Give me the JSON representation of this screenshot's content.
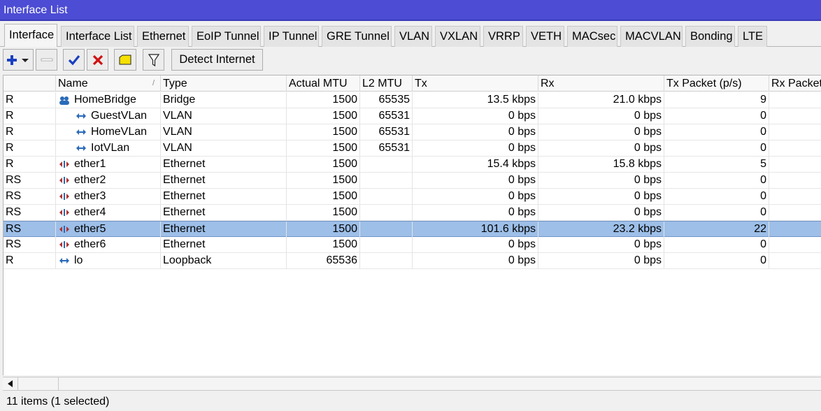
{
  "window": {
    "title": "Interface List"
  },
  "tabs": [
    {
      "label": "Interface",
      "active": true
    },
    {
      "label": "Interface List"
    },
    {
      "label": "Ethernet"
    },
    {
      "label": "EoIP Tunnel"
    },
    {
      "label": "IP Tunnel"
    },
    {
      "label": "GRE Tunnel"
    },
    {
      "label": "VLAN"
    },
    {
      "label": "VXLAN"
    },
    {
      "label": "VRRP"
    },
    {
      "label": "VETH"
    },
    {
      "label": "MACsec"
    },
    {
      "label": "MACVLAN"
    },
    {
      "label": "Bonding"
    },
    {
      "label": "LTE"
    }
  ],
  "toolbar": {
    "add_icon": "plus-dropdown-icon",
    "remove_icon": "minus-icon",
    "enable_icon": "checkmark-icon",
    "disable_icon": "x-icon",
    "comment_icon": "comment-note-icon",
    "filter_icon": "funnel-filter-icon",
    "detect_label": "Detect Internet"
  },
  "table": {
    "columns": [
      "",
      "Name",
      "Type",
      "Actual MTU",
      "L2 MTU",
      "Tx",
      "Rx",
      "Tx Packet (p/s)",
      "Rx Packet"
    ],
    "sort_indicator": "/",
    "rows": [
      {
        "flags": "R",
        "icon": "bridge-icon",
        "name": "HomeBridge",
        "type": "Bridge",
        "mtu": "1500",
        "l2mtu": "65535",
        "tx": "13.5 kbps",
        "rx": "21.0 kbps",
        "txp": "9",
        "indent": 0
      },
      {
        "flags": "R",
        "icon": "vlan-icon",
        "name": "GuestVLan",
        "type": "VLAN",
        "mtu": "1500",
        "l2mtu": "65531",
        "tx": "0 bps",
        "rx": "0 bps",
        "txp": "0",
        "indent": 1
      },
      {
        "flags": "R",
        "icon": "vlan-icon",
        "name": "HomeVLan",
        "type": "VLAN",
        "mtu": "1500",
        "l2mtu": "65531",
        "tx": "0 bps",
        "rx": "0 bps",
        "txp": "0",
        "indent": 1
      },
      {
        "flags": "R",
        "icon": "vlan-icon",
        "name": "IotVLan",
        "type": "VLAN",
        "mtu": "1500",
        "l2mtu": "65531",
        "tx": "0 bps",
        "rx": "0 bps",
        "txp": "0",
        "indent": 1
      },
      {
        "flags": "R",
        "icon": "ethernet-icon",
        "name": "ether1",
        "type": "Ethernet",
        "mtu": "1500",
        "l2mtu": "",
        "tx": "15.4 kbps",
        "rx": "15.8 kbps",
        "txp": "5",
        "indent": 0
      },
      {
        "flags": "RS",
        "icon": "ethernet-icon",
        "name": "ether2",
        "type": "Ethernet",
        "mtu": "1500",
        "l2mtu": "",
        "tx": "0 bps",
        "rx": "0 bps",
        "txp": "0",
        "indent": 0
      },
      {
        "flags": "RS",
        "icon": "ethernet-icon",
        "name": "ether3",
        "type": "Ethernet",
        "mtu": "1500",
        "l2mtu": "",
        "tx": "0 bps",
        "rx": "0 bps",
        "txp": "0",
        "indent": 0
      },
      {
        "flags": "RS",
        "icon": "ethernet-icon",
        "name": "ether4",
        "type": "Ethernet",
        "mtu": "1500",
        "l2mtu": "",
        "tx": "0 bps",
        "rx": "0 bps",
        "txp": "0",
        "indent": 0
      },
      {
        "flags": "RS",
        "icon": "ethernet-icon",
        "name": "ether5",
        "type": "Ethernet",
        "mtu": "1500",
        "l2mtu": "",
        "tx": "101.6 kbps",
        "rx": "23.2 kbps",
        "txp": "22",
        "indent": 0,
        "selected": true
      },
      {
        "flags": "RS",
        "icon": "ethernet-icon",
        "name": "ether6",
        "type": "Ethernet",
        "mtu": "1500",
        "l2mtu": "",
        "tx": "0 bps",
        "rx": "0 bps",
        "txp": "0",
        "indent": 0
      },
      {
        "flags": "R",
        "icon": "loopback-icon",
        "name": "lo",
        "type": "Loopback",
        "mtu": "65536",
        "l2mtu": "",
        "tx": "0 bps",
        "rx": "0 bps",
        "txp": "0",
        "indent": 0
      }
    ]
  },
  "scrollbar": {
    "left_arrow_icon": "arrow-left-icon"
  },
  "status": {
    "text": "11 items (1 selected)"
  },
  "colors": {
    "titlebar": "#4c4cd4",
    "selection": "#9dbfe8",
    "add": "#1a3fc0",
    "remove": "#d01010",
    "comment": "#f6e000"
  }
}
